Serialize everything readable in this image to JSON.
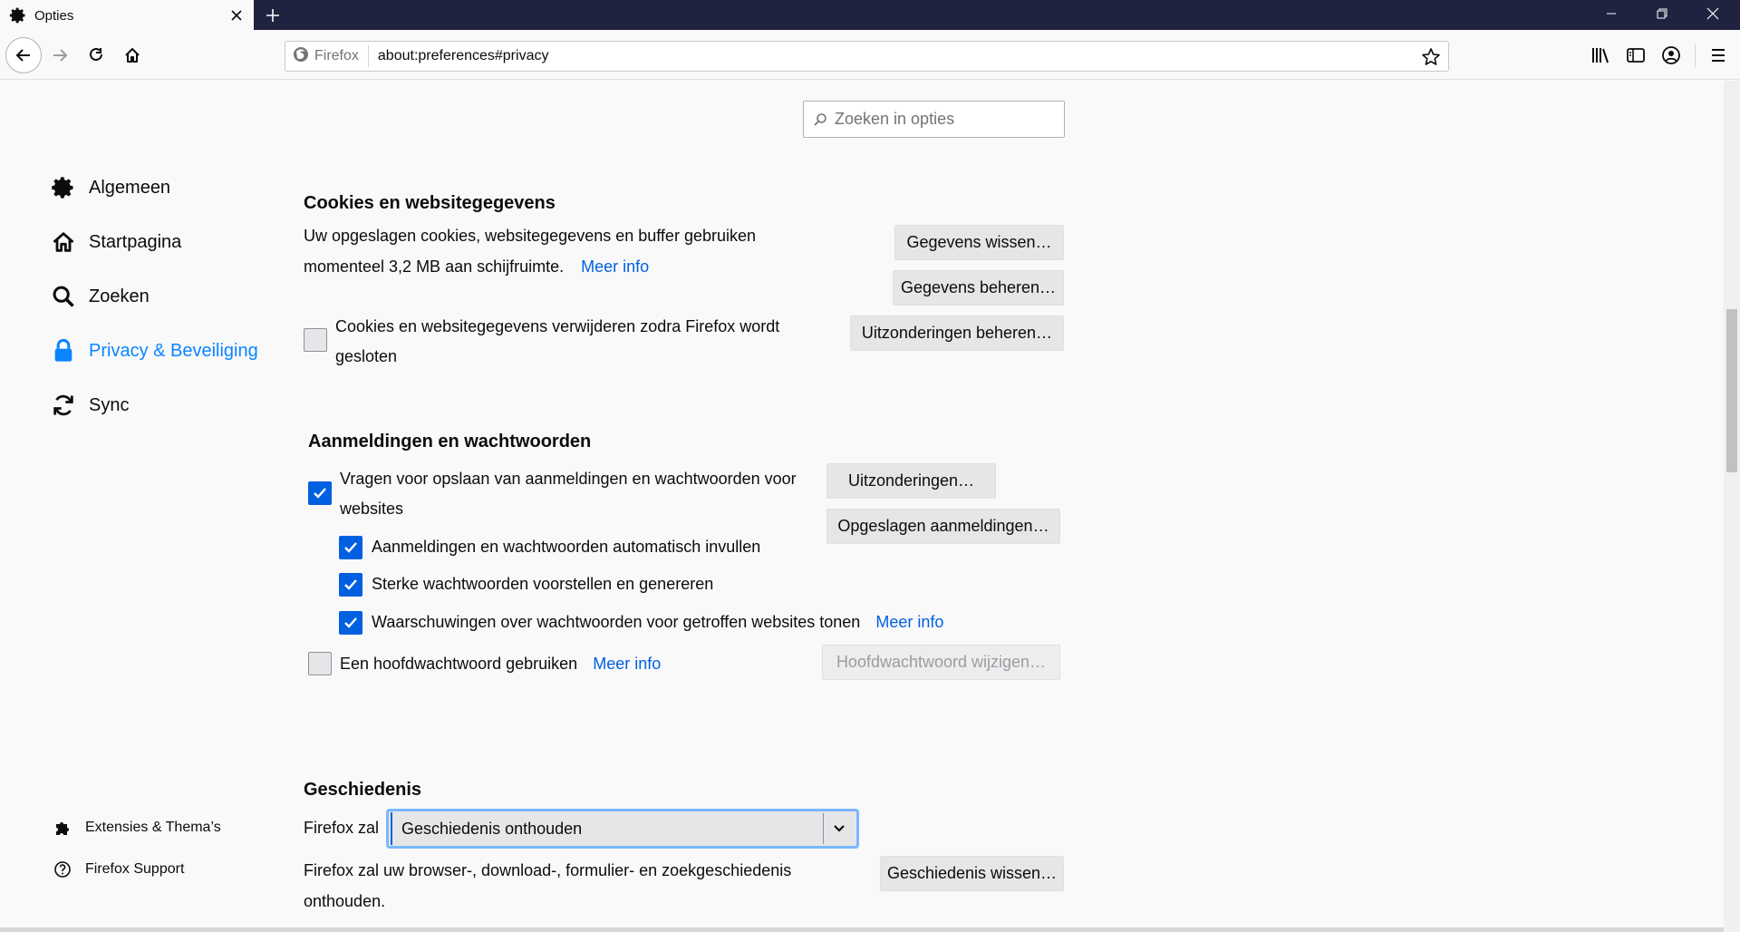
{
  "tab": {
    "title": "Opties",
    "icon": "gear-icon"
  },
  "toolbar": {
    "identity_label": "Firefox",
    "url": "about:preferences#privacy"
  },
  "search": {
    "placeholder": "Zoeken in opties"
  },
  "sidebar": {
    "items": [
      {
        "label": "Algemeen",
        "icon": "gear-icon"
      },
      {
        "label": "Startpagina",
        "icon": "home-icon"
      },
      {
        "label": "Zoeken",
        "icon": "search-icon"
      },
      {
        "label": "Privacy & Beveiliging",
        "icon": "lock-icon",
        "selected": true
      },
      {
        "label": "Sync",
        "icon": "sync-icon"
      }
    ],
    "footer": [
      {
        "label": "Extensies & Thema’s",
        "icon": "puzzle-icon"
      },
      {
        "label": "Firefox Support",
        "icon": "help-icon"
      }
    ]
  },
  "cookies": {
    "heading": "Cookies en websitegegevens",
    "desc_line1": "Uw opgeslagen cookies, websitegegevens en buffer gebruiken",
    "desc_line2": "momenteel 3,2 MB aan schijfruimte.",
    "more_info": "Meer info",
    "btn_clear": "Gegevens wissen…",
    "btn_manage": "Gegevens beheren…",
    "btn_exceptions": "Uitzonderingen beheren…",
    "delete_on_close_line1": "Cookies en websitegegevens verwijderen zodra Firefox wordt",
    "delete_on_close_line2": "gesloten",
    "delete_on_close_checked": false
  },
  "logins": {
    "heading": "Aanmeldingen en wachtwoorden",
    "ask_save_line1": "Vragen voor opslaan van aanmeldingen en wachtwoorden voor",
    "ask_save_line2": "websites",
    "ask_save_checked": true,
    "autofill": "Aanmeldingen en wachtwoorden automatisch invullen",
    "autofill_checked": true,
    "suggest": "Sterke wachtwoorden voorstellen en genereren",
    "suggest_checked": true,
    "breach_alerts": "Waarschuwingen over wachtwoorden voor getroffen websites tonen",
    "breach_alerts_checked": true,
    "breach_more_info": "Meer info",
    "master_password": "Een hoofdwachtwoord gebruiken",
    "master_password_checked": false,
    "master_more_info": "Meer info",
    "btn_exceptions": "Uitzonderingen…",
    "btn_saved": "Opgeslagen aanmeldingen…",
    "btn_change_master": "Hoofdwachtwoord wijzigen…"
  },
  "history": {
    "heading": "Geschiedenis",
    "firefox_will": "Firefox zal",
    "mode": "Geschiedenis onthouden",
    "desc_line1": "Firefox zal uw browser-, download-, formulier- en zoekgeschiedenis",
    "desc_line2": "onthouden.",
    "btn_clear": "Geschiedenis wissen…"
  },
  "colors": {
    "accent": "#0a84ff",
    "link": "#0060df",
    "titlebar": "#202340"
  }
}
